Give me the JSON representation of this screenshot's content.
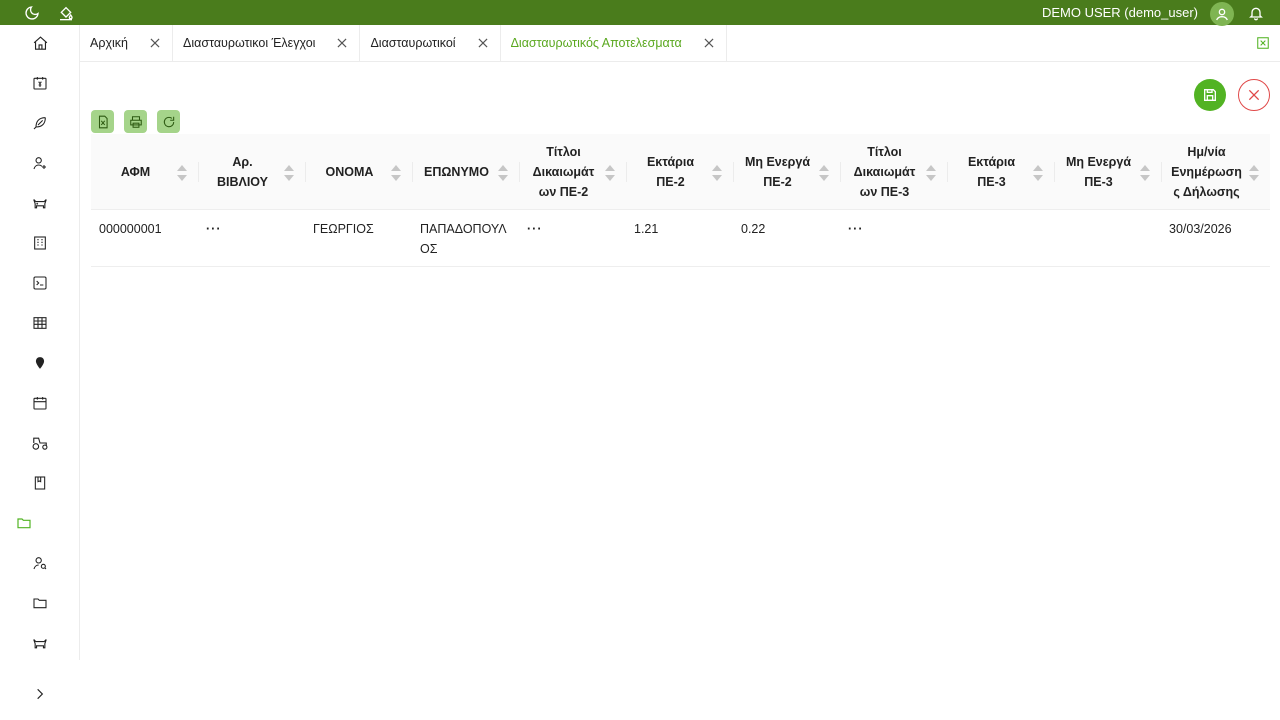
{
  "topbar": {
    "user_label": "DEMO USER (demo_user)",
    "left_icons": [
      "moon-icon",
      "paint-bucket-icon"
    ],
    "right_icons": [
      "user-avatar-icon",
      "bell-icon"
    ]
  },
  "sidebar": {
    "items": [
      {
        "icon": "home-icon"
      },
      {
        "icon": "calendar-money-icon"
      },
      {
        "icon": "feather-icon"
      },
      {
        "icon": "user-add-icon"
      },
      {
        "icon": "cow-icon"
      },
      {
        "icon": "building-icon"
      },
      {
        "icon": "terminal-icon"
      },
      {
        "icon": "table-icon"
      },
      {
        "icon": "map-pin-icon"
      },
      {
        "icon": "calendar-icon"
      },
      {
        "icon": "tractor-icon"
      },
      {
        "icon": "book-icon"
      },
      {
        "icon": "folder-icon",
        "active": true
      },
      {
        "icon": "user-search-icon"
      },
      {
        "icon": "folder-icon"
      },
      {
        "icon": "cow-icon"
      }
    ],
    "expand_icon": "chevron-right-icon"
  },
  "tabs": [
    {
      "label": "Αρχική"
    },
    {
      "label": "Διασταυρωτικοι Έλεγχοι"
    },
    {
      "label": "Διασταυρωτικοί"
    },
    {
      "label": "Διασταυρωτικός Αποτελεσματα",
      "active": true
    }
  ],
  "colors": {
    "brand": "#4a7c1c",
    "accent": "#52b323",
    "active_tab": "#5aa81f",
    "danger": "#e04848",
    "tool_button": "#a5d48a"
  },
  "table": {
    "columns": [
      "ΑΦΜ",
      "Αρ. ΒΙΒΛΙΟΥ",
      "ΟΝΟΜΑ",
      "ΕΠΩΝΥΜΟ",
      "Τίτλοι Δικαιωμάτ ων ΠΕ-2",
      "Εκτάρια ΠΕ-2",
      "Μη Ενεργά ΠΕ-2",
      "Τίτλοι Δικαιωμάτ ων ΠΕ-3",
      "Εκτάρια ΠΕ-3",
      "Μη Ενεργά ΠΕ-3",
      "Ημ/νία Ενημέρωση ς Δήλωσης"
    ],
    "rows": [
      [
        "000000001",
        "···",
        "ΓΕΩΡΓΙΟΣ",
        "ΠΑΠΑΔΟΠΟΥΛ ΟΣ",
        "···",
        "1.21",
        "0.22",
        "···",
        "",
        "",
        "30/03/2026"
      ]
    ]
  }
}
